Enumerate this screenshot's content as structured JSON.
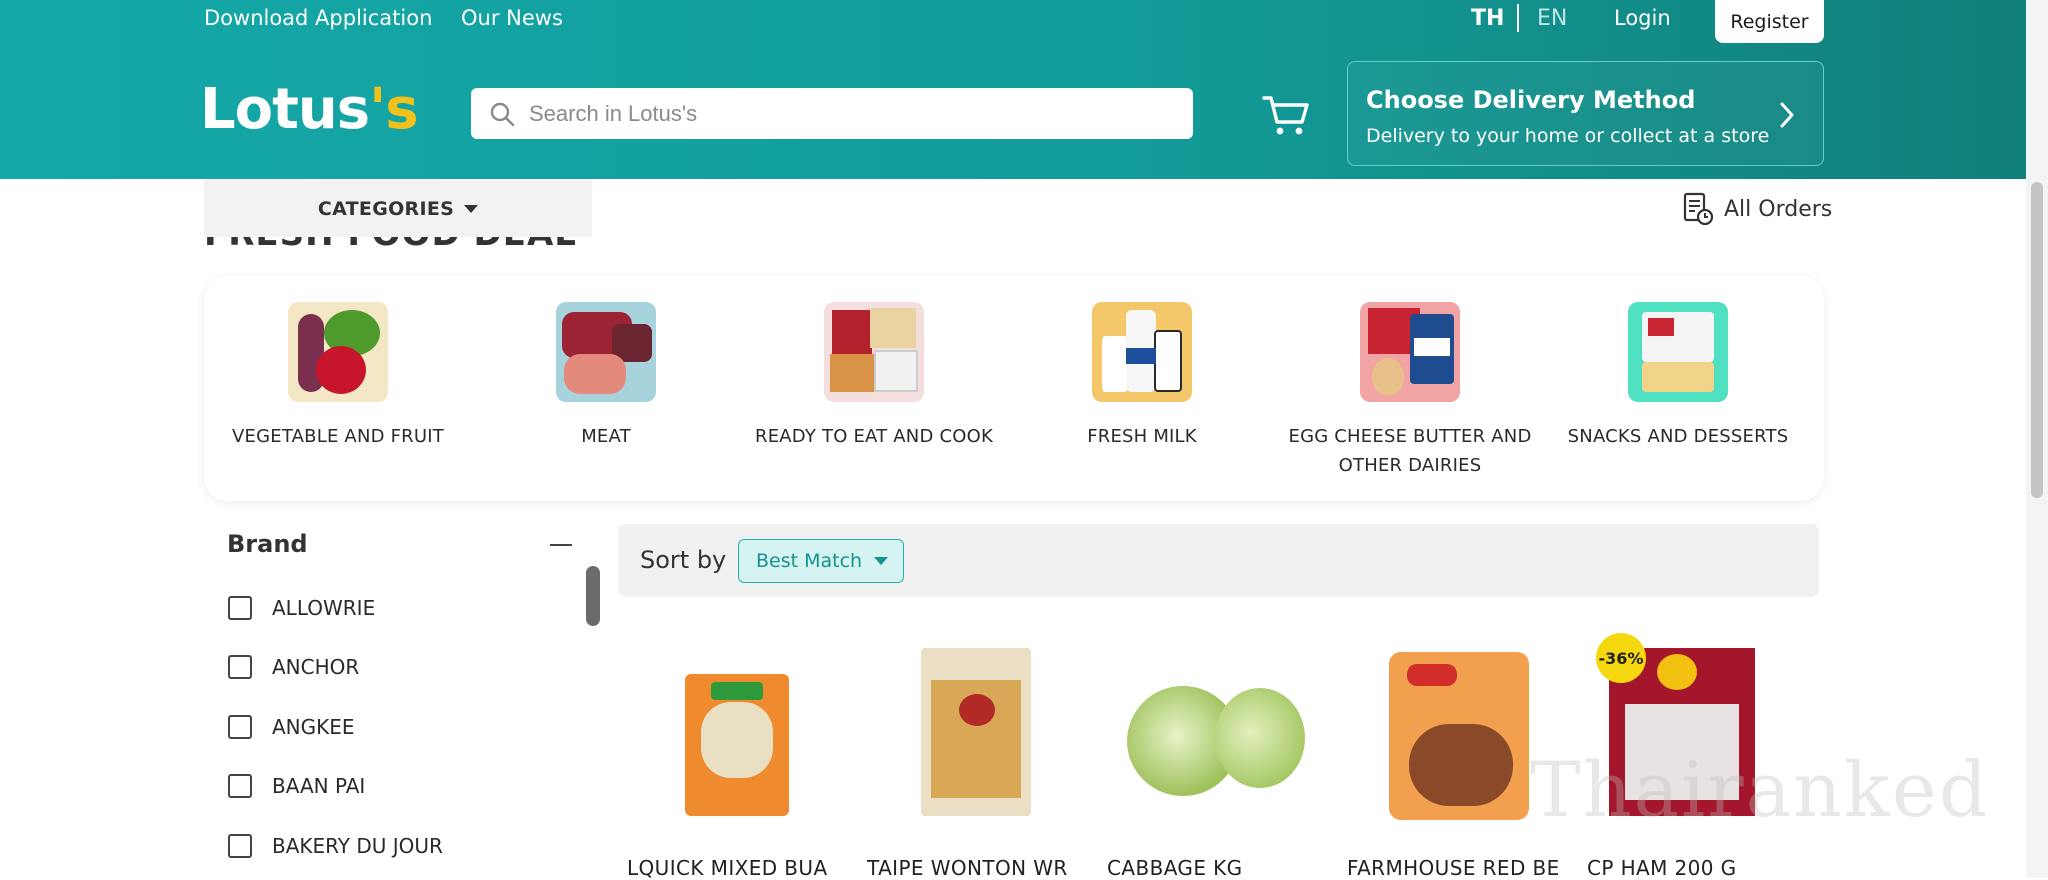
{
  "top_nav": {
    "download_app": "Download Application",
    "our_news": "Our News",
    "lang_th": "TH",
    "lang_en": "EN",
    "login": "Login",
    "register": "Register"
  },
  "header": {
    "logo_main": "Lotus",
    "logo_accent": "'s",
    "search_placeholder": "Search in Lotus's",
    "delivery_title": "Choose Delivery Method",
    "delivery_subtitle": "Delivery to your home or collect at a store"
  },
  "subnav": {
    "categories": "CATEGORIES",
    "all_orders": "All Orders"
  },
  "section_title": "FRESH FOOD DEAL",
  "categories": [
    {
      "label": "VEGETABLE AND FRUIT"
    },
    {
      "label": "MEAT"
    },
    {
      "label": "READY TO EAT AND COOK"
    },
    {
      "label": "FRESH MILK"
    },
    {
      "label": "EGG CHEESE BUTTER AND OTHER DAIRIES"
    },
    {
      "label": "SNACKS AND DESSERTS"
    }
  ],
  "filters": {
    "brand_title": "Brand",
    "brands": [
      "ALLOWRIE",
      "ANCHOR",
      "ANGKEE",
      "BAAN PAI",
      "BAKERY DU JOUR"
    ]
  },
  "sort": {
    "label": "Sort by",
    "selected": "Best Match"
  },
  "products": [
    {
      "name": "LQUICK MIXED BUA"
    },
    {
      "name": "TAIPE WONTON WR"
    },
    {
      "name": "CABBAGE KG"
    },
    {
      "name": "FARMHOUSE RED BE"
    },
    {
      "name": "CP HAM 200 G",
      "discount": "-36%"
    }
  ],
  "watermark": "Thairanked",
  "colors": {
    "brand_teal": "#14a8a8",
    "brand_yellow": "#f3c21a",
    "sort_accent": "#14938f"
  }
}
